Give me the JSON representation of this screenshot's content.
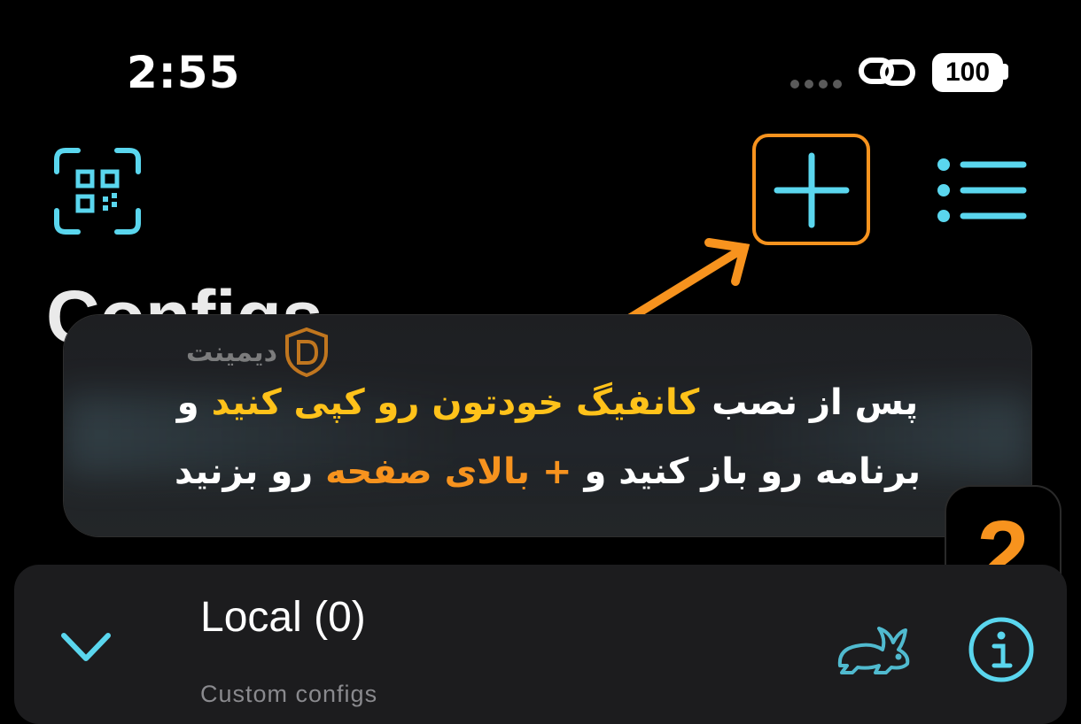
{
  "status_bar": {
    "time": "2:55",
    "battery": "100"
  },
  "nav": {
    "scan_icon": "qr-scan-icon",
    "add_icon": "plus-icon",
    "menu_icon": "list-icon",
    "accent_color": "#5ad6ee",
    "highlight_color": "#f7931e"
  },
  "page": {
    "title": "Configs"
  },
  "banner": {
    "logo_text": "دیمینت",
    "line1_part1": "پس از نصب ",
    "line1_highlight": "کانفیگ خودتون رو کپی کنید",
    "line1_part2": " و",
    "line2_part1": "برنامه رو باز کنید و ",
    "line2_highlight": "+ بالای صفحه",
    "line2_part2": " رو بزنید",
    "step_number": "2"
  },
  "config_group": {
    "title": "Local (0)",
    "subtitle": "Custom configs",
    "speed_icon": "rabbit-icon",
    "info_icon": "info-icon",
    "expand_icon": "chevron-down-icon"
  }
}
